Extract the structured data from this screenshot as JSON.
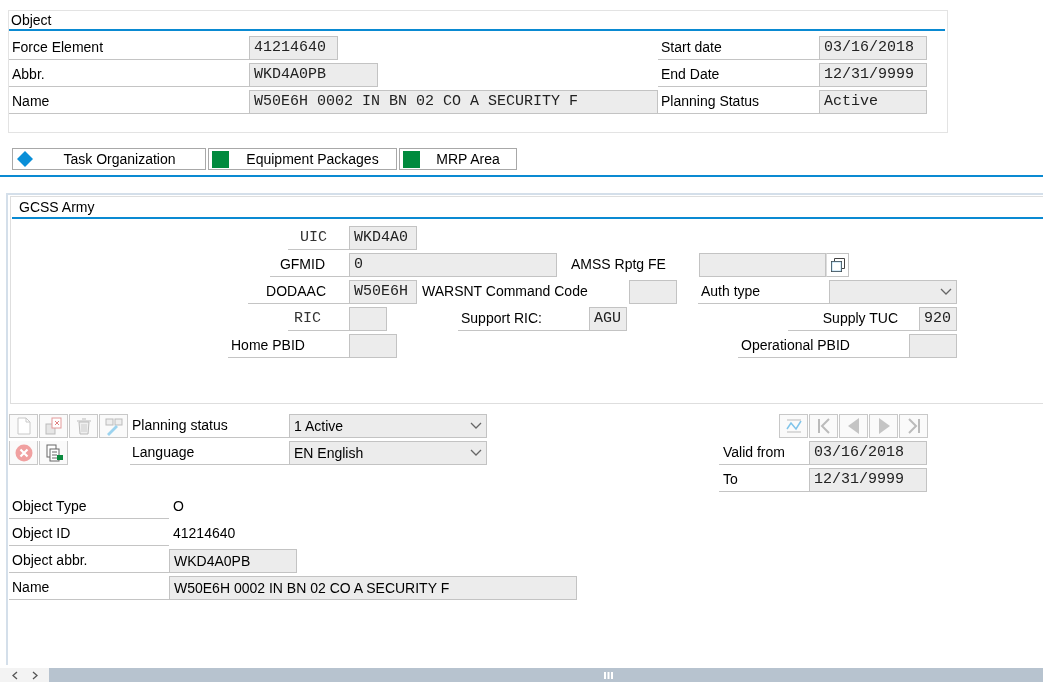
{
  "object_panel": {
    "title": "Object",
    "rows": [
      [
        {
          "label": "Force Element",
          "value": "41214640"
        },
        {
          "label": "Start date",
          "value": "03/16/2018"
        }
      ],
      [
        {
          "label": "Abbr.",
          "value": "WKD4A0PB"
        },
        {
          "label": "End Date",
          "value": "12/31/9999"
        }
      ],
      [
        {
          "label": "Name",
          "value": "W50E6H 0002 IN BN 02 CO A SECURITY F"
        },
        {
          "label": "Planning Status",
          "value": "Active"
        }
      ]
    ]
  },
  "tabs": [
    {
      "label": "Task Organization",
      "kind": "diamond",
      "color": "#0a8fd8"
    },
    {
      "label": "Equipment Packages",
      "kind": "square",
      "color": "#008a3e"
    },
    {
      "label": "MRP Area",
      "kind": "square",
      "color": "#008a3e"
    }
  ],
  "gcss_panel": {
    "title": "GCSS Army",
    "rows": [
      [
        {
          "label": "UIC",
          "value": "WKD4A0",
          "kind": "input"
        }
      ],
      [
        {
          "label": "GFMID",
          "value": "0",
          "kind": "input"
        },
        {
          "label": "AMSS Rptg FE",
          "kind": "f4"
        }
      ],
      [
        {
          "label": "DODAAC",
          "value": "W50E6H",
          "kind": "input"
        },
        {
          "label": "WARSNT Command Code",
          "kind": "input"
        },
        {
          "label": "Auth type",
          "kind": "dropdown"
        }
      ],
      [
        {
          "label": "RIC",
          "kind": "input"
        },
        {
          "label": "Support RIC:",
          "value": "AGU",
          "kind": "input"
        },
        {
          "label": "Supply TUC",
          "value": "920",
          "kind": "input"
        }
      ],
      [
        {
          "label": "Home PBID",
          "kind": "input"
        },
        {
          "label": "Operational PBID",
          "kind": "input"
        }
      ]
    ]
  },
  "header_fields": [
    {
      "label": "Planning status",
      "value": "1 Active",
      "kind": "dropdown"
    },
    {
      "label": "Language",
      "value": "EN English",
      "kind": "dropdown"
    }
  ],
  "validity_fields": [
    {
      "label": "Valid from",
      "value": "03/16/2018",
      "kind": "input"
    },
    {
      "label": "To",
      "value": "12/31/9999",
      "kind": "input"
    }
  ],
  "object_info": [
    {
      "label": "Object Type",
      "value": "O",
      "kind": "text"
    },
    {
      "label": "Object ID",
      "value": "41214640",
      "kind": "text"
    },
    {
      "label": "Object abbr.",
      "value": "WKD4A0PB",
      "kind": "input"
    },
    {
      "label": "Name",
      "value": "W50E6H 0002 IN BN 02 CO A SECURITY F",
      "kind": "input"
    }
  ]
}
